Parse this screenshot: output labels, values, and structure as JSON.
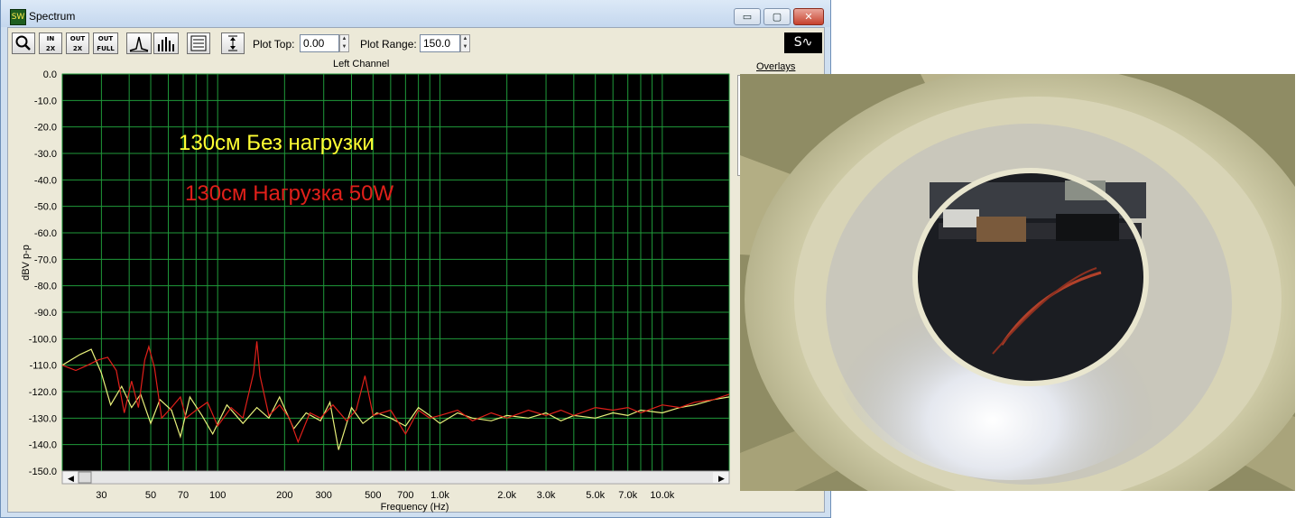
{
  "window": {
    "title": "Spectrum",
    "app_icon_text": "SW",
    "buttons": {
      "minimize": "▭",
      "maximize": "▢",
      "close": "✕"
    }
  },
  "toolbar": {
    "zoom_icon": "magnifier-icon",
    "zoom_in_2x": {
      "top": "IN",
      "bottom": "2X"
    },
    "zoom_out_2x": {
      "top": "OUT",
      "bottom": "2X"
    },
    "zoom_out_full": {
      "top": "OUT",
      "bottom": "FULL"
    },
    "plot_top_label": "Plot Top:",
    "plot_top_value": "0.00",
    "plot_range_label": "Plot Range:",
    "plot_range_value": "150.0",
    "spectrum_mode_glyph": "S∿"
  },
  "panel": {
    "channel_title": "Left Channel",
    "overlays_label": "Overlays"
  },
  "chart_data": {
    "type": "line",
    "title": "Left Channel",
    "xlabel": "Frequency (Hz)",
    "ylabel": "dBV p-p",
    "x_scale": "log",
    "xlim": [
      20,
      20000
    ],
    "ylim": [
      -150,
      0
    ],
    "grid": true,
    "y_ticks": [
      "0.0",
      "-10.0",
      "-20.0",
      "-30.0",
      "-40.0",
      "-50.0",
      "-60.0",
      "-70.0",
      "-80.0",
      "-90.0",
      "-100.0",
      "-110.0",
      "-120.0",
      "-130.0",
      "-140.0",
      "-150.0"
    ],
    "x_ticks": [
      {
        "value": 30,
        "label": "30"
      },
      {
        "value": 50,
        "label": "50"
      },
      {
        "value": 70,
        "label": "70"
      },
      {
        "value": 100,
        "label": "100"
      },
      {
        "value": 200,
        "label": "200"
      },
      {
        "value": 300,
        "label": "300"
      },
      {
        "value": 500,
        "label": "500"
      },
      {
        "value": 700,
        "label": "700"
      },
      {
        "value": 1000,
        "label": "1.0k"
      },
      {
        "value": 2000,
        "label": "2.0k"
      },
      {
        "value": 3000,
        "label": "3.0k"
      },
      {
        "value": 5000,
        "label": "5.0k"
      },
      {
        "value": 7000,
        "label": "7.0k"
      },
      {
        "value": 10000,
        "label": "10.0k"
      }
    ],
    "annotations": [
      {
        "text": "130см Без нагрузки",
        "color": "#ffff33"
      },
      {
        "text": "130см Нагрузка 50W",
        "color": "#e0201a"
      }
    ],
    "series": [
      {
        "color": "#e8f07a",
        "points": [
          [
            20,
            -110
          ],
          [
            24,
            -106
          ],
          [
            27,
            -104
          ],
          [
            30,
            -113
          ],
          [
            33,
            -125
          ],
          [
            37,
            -118
          ],
          [
            41,
            -126
          ],
          [
            45,
            -121
          ],
          [
            50,
            -132
          ],
          [
            55,
            -123
          ],
          [
            62,
            -127
          ],
          [
            68,
            -137
          ],
          [
            75,
            -122
          ],
          [
            85,
            -129
          ],
          [
            95,
            -136
          ],
          [
            110,
            -125
          ],
          [
            130,
            -132
          ],
          [
            150,
            -126
          ],
          [
            170,
            -130
          ],
          [
            190,
            -122
          ],
          [
            220,
            -134
          ],
          [
            250,
            -128
          ],
          [
            290,
            -131
          ],
          [
            320,
            -124
          ],
          [
            350,
            -142
          ],
          [
            400,
            -126
          ],
          [
            450,
            -132
          ],
          [
            520,
            -128
          ],
          [
            600,
            -130
          ],
          [
            700,
            -133
          ],
          [
            800,
            -126
          ],
          [
            900,
            -129
          ],
          [
            1000,
            -132
          ],
          [
            1200,
            -128
          ],
          [
            1400,
            -130
          ],
          [
            1700,
            -131
          ],
          [
            2000,
            -129
          ],
          [
            2500,
            -130
          ],
          [
            3000,
            -128
          ],
          [
            3500,
            -131
          ],
          [
            4000,
            -129
          ],
          [
            5000,
            -130
          ],
          [
            6000,
            -128
          ],
          [
            7000,
            -129
          ],
          [
            8000,
            -127
          ],
          [
            10000,
            -128
          ],
          [
            12000,
            -126
          ],
          [
            14000,
            -125
          ],
          [
            17000,
            -123
          ],
          [
            20000,
            -122
          ]
        ]
      },
      {
        "color": "#e0201a",
        "points": [
          [
            20,
            -110
          ],
          [
            23,
            -112
          ],
          [
            26,
            -110
          ],
          [
            29,
            -108
          ],
          [
            32,
            -107
          ],
          [
            35,
            -112
          ],
          [
            38,
            -128
          ],
          [
            41,
            -116
          ],
          [
            44,
            -126
          ],
          [
            47,
            -108
          ],
          [
            49,
            -103
          ],
          [
            52,
            -111
          ],
          [
            56,
            -130
          ],
          [
            62,
            -126
          ],
          [
            68,
            -122
          ],
          [
            72,
            -130
          ],
          [
            80,
            -127
          ],
          [
            90,
            -124
          ],
          [
            100,
            -133
          ],
          [
            115,
            -126
          ],
          [
            130,
            -130
          ],
          [
            145,
            -113
          ],
          [
            150,
            -101
          ],
          [
            155,
            -114
          ],
          [
            170,
            -129
          ],
          [
            190,
            -125
          ],
          [
            210,
            -130
          ],
          [
            230,
            -139
          ],
          [
            260,
            -128
          ],
          [
            290,
            -130
          ],
          [
            330,
            -125
          ],
          [
            380,
            -131
          ],
          [
            420,
            -127
          ],
          [
            460,
            -114
          ],
          [
            500,
            -129
          ],
          [
            600,
            -127
          ],
          [
            700,
            -136
          ],
          [
            800,
            -127
          ],
          [
            900,
            -130
          ],
          [
            1000,
            -129
          ],
          [
            1200,
            -127
          ],
          [
            1400,
            -131
          ],
          [
            1700,
            -128
          ],
          [
            2000,
            -130
          ],
          [
            2500,
            -127
          ],
          [
            3000,
            -129
          ],
          [
            3500,
            -127
          ],
          [
            4000,
            -129
          ],
          [
            5000,
            -126
          ],
          [
            6000,
            -127
          ],
          [
            7000,
            -126
          ],
          [
            8000,
            -128
          ],
          [
            10000,
            -125
          ],
          [
            12000,
            -126
          ],
          [
            14000,
            -124
          ],
          [
            17000,
            -123
          ],
          [
            20000,
            -121
          ]
        ]
      }
    ]
  },
  "photo": {
    "description_icon": "coil-former-viewport-photo"
  }
}
